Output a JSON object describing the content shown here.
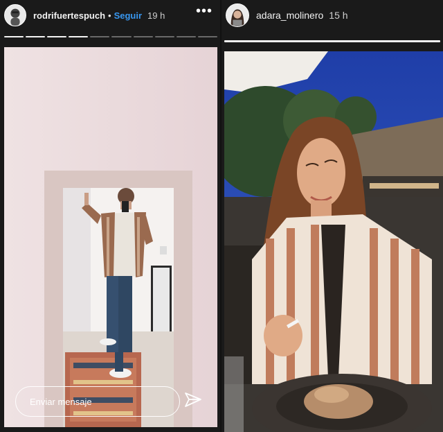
{
  "left_story": {
    "username": "rodrifuertespuch",
    "separator": "•",
    "follow_label": "Seguir",
    "time": "19 h",
    "more_label": "•••",
    "progress": {
      "total": 10,
      "viewed": 4
    },
    "reply_placeholder": "Enviar mensaje"
  },
  "right_story": {
    "username": "adara_molinero",
    "time": "15 h",
    "progress": {
      "total": 1,
      "viewed": 1
    }
  },
  "colors": {
    "follow": "#3897f0",
    "background": "#1a1a1a"
  },
  "icons": {
    "more": "more-options-icon",
    "send": "send-direct-icon"
  }
}
